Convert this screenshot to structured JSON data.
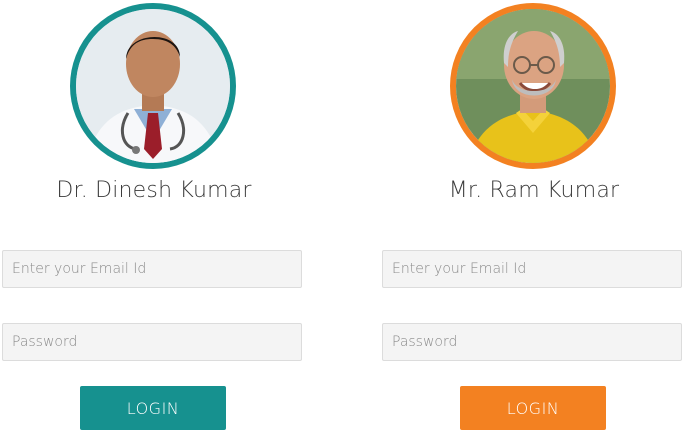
{
  "colors": {
    "teal": "#16918f",
    "orange": "#f38121",
    "input_bg": "#f4f4f4",
    "input_border": "#dcdcdc",
    "name_text": "#3a3a3a"
  },
  "users": [
    {
      "name": "Dr. Dinesh Kumar",
      "avatar_icon": "doctor-avatar-icon",
      "email_placeholder": "Enter your Email Id",
      "email_value": "",
      "password_placeholder": "Password",
      "password_value": "",
      "login_label": "LOGIN"
    },
    {
      "name": "Mr. Ram Kumar",
      "avatar_icon": "patient-avatar-icon",
      "email_placeholder": "Enter your Email Id",
      "email_value": "",
      "password_placeholder": "Password",
      "password_value": "",
      "login_label": "LOGIN"
    }
  ]
}
